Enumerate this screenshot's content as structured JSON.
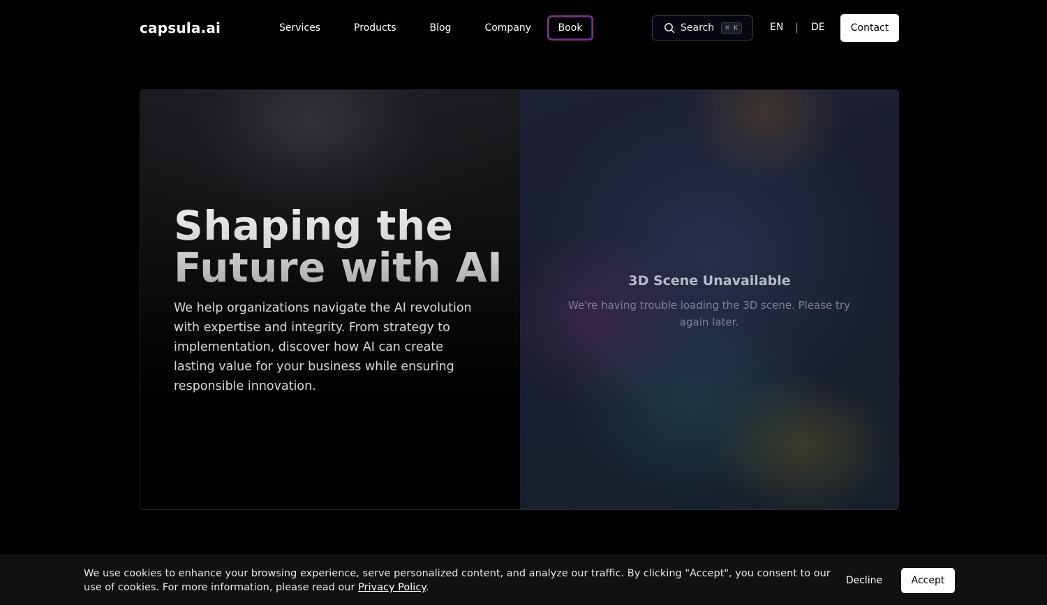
{
  "nav": {
    "logo": "capsula.ai",
    "links": [
      "Services",
      "Products",
      "Blog",
      "Company"
    ],
    "book_label": "Book",
    "search_label": "Search",
    "search_shortcut": "⌘ K",
    "lang_en": "EN",
    "lang_separator": "|",
    "lang_de": "DE",
    "contact_label": "Contact"
  },
  "hero": {
    "title_line1": "Shaping the",
    "title_line2": "Future with AI",
    "description": "We help organizations navigate the AI revolution with expertise and integrity. From strategy to implementation, discover how AI can create lasting value for your business while ensuring responsible innovation.",
    "scene_title": "3D Scene Unavailable",
    "scene_message": "We're having trouble loading the 3D scene. Please try again later."
  },
  "cookie": {
    "text_before": "We use cookies to enhance your browsing experience, serve personalized content, and analyze our traffic. By clicking \"Accept\", you consent to our use of cookies. For more information, please read our ",
    "privacy_link": "Privacy Policy",
    "text_after": ".",
    "decline_label": "Decline",
    "accept_label": "Accept"
  },
  "colors": {
    "background": "#000000",
    "book_border": "#8a2f7a",
    "scene_bg": "#1c2033",
    "cookie_bg": "#111114"
  }
}
